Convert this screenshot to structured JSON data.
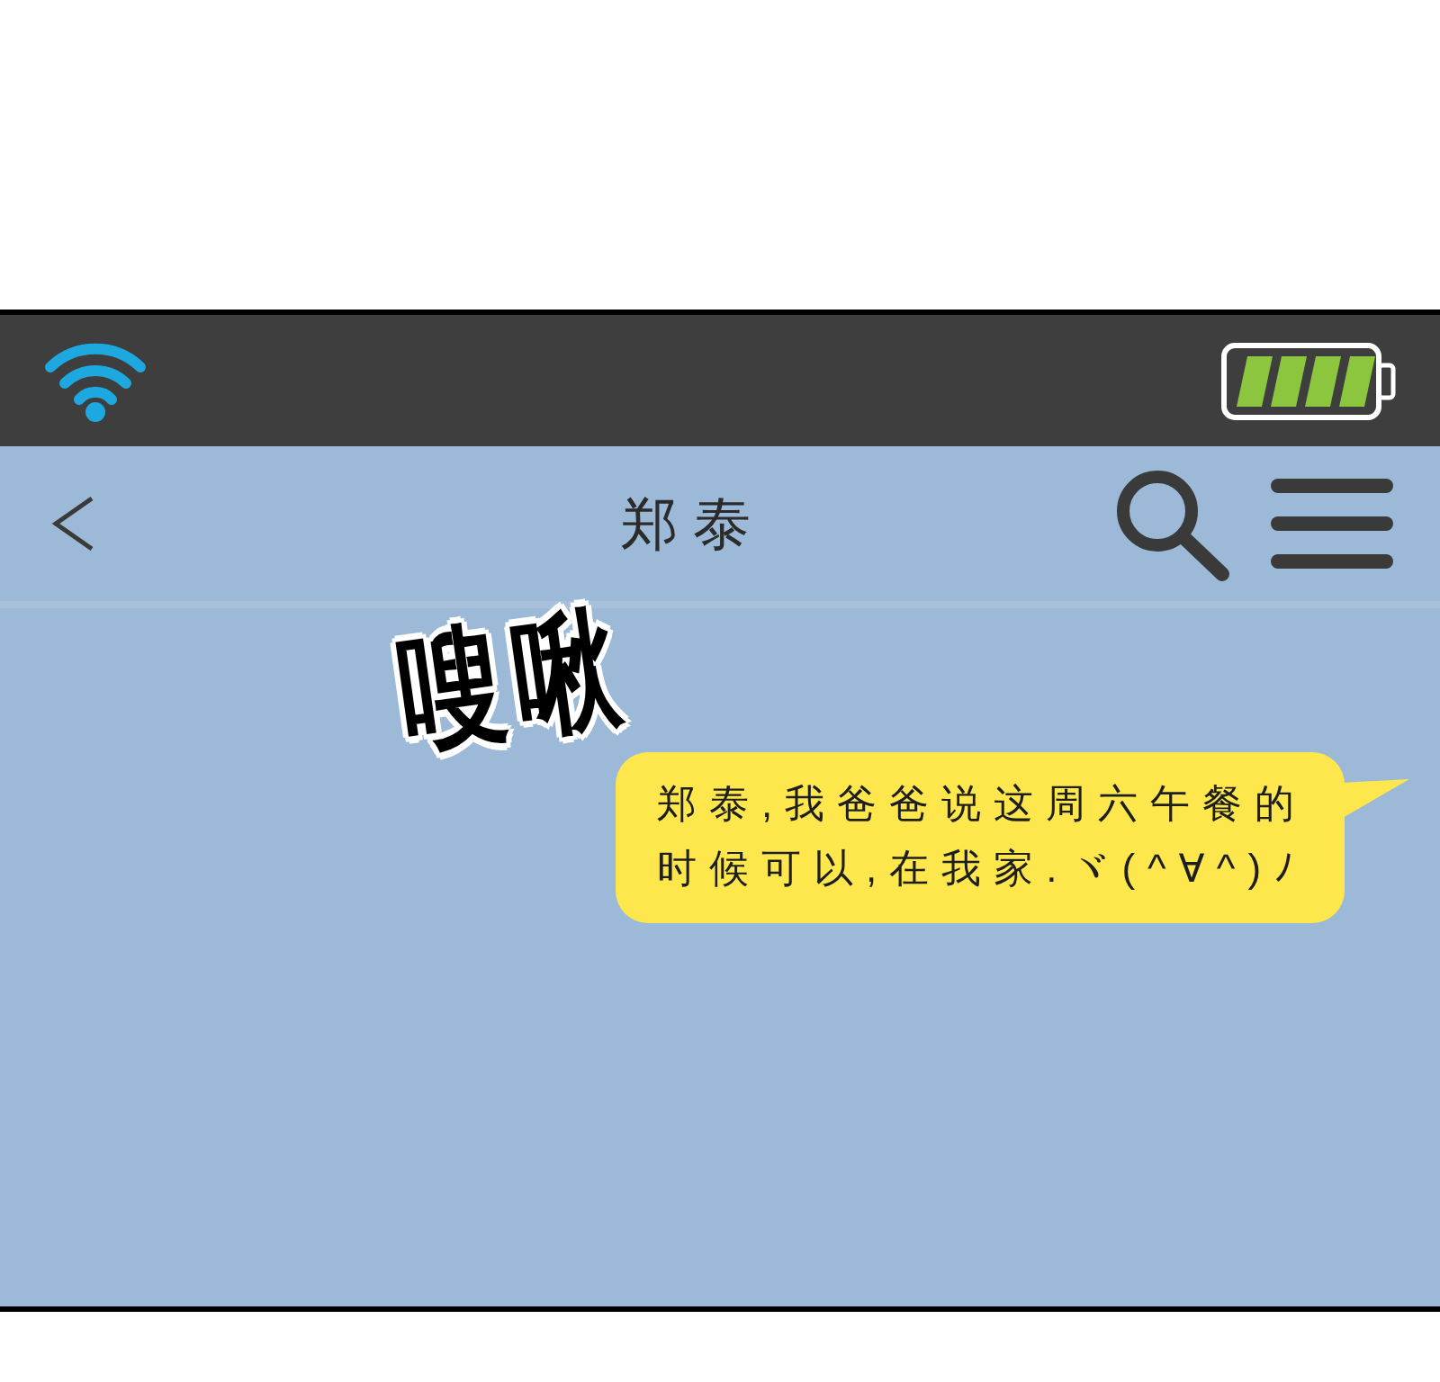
{
  "header": {
    "title": "郑泰"
  },
  "sound_effect": "嗖啾",
  "messages": [
    {
      "outgoing": true,
      "lines": [
        "郑泰,我爸爸说这周六午餐的",
        "时候可以,在我家.ヾ(^∀^)ﾉ"
      ]
    }
  ]
}
